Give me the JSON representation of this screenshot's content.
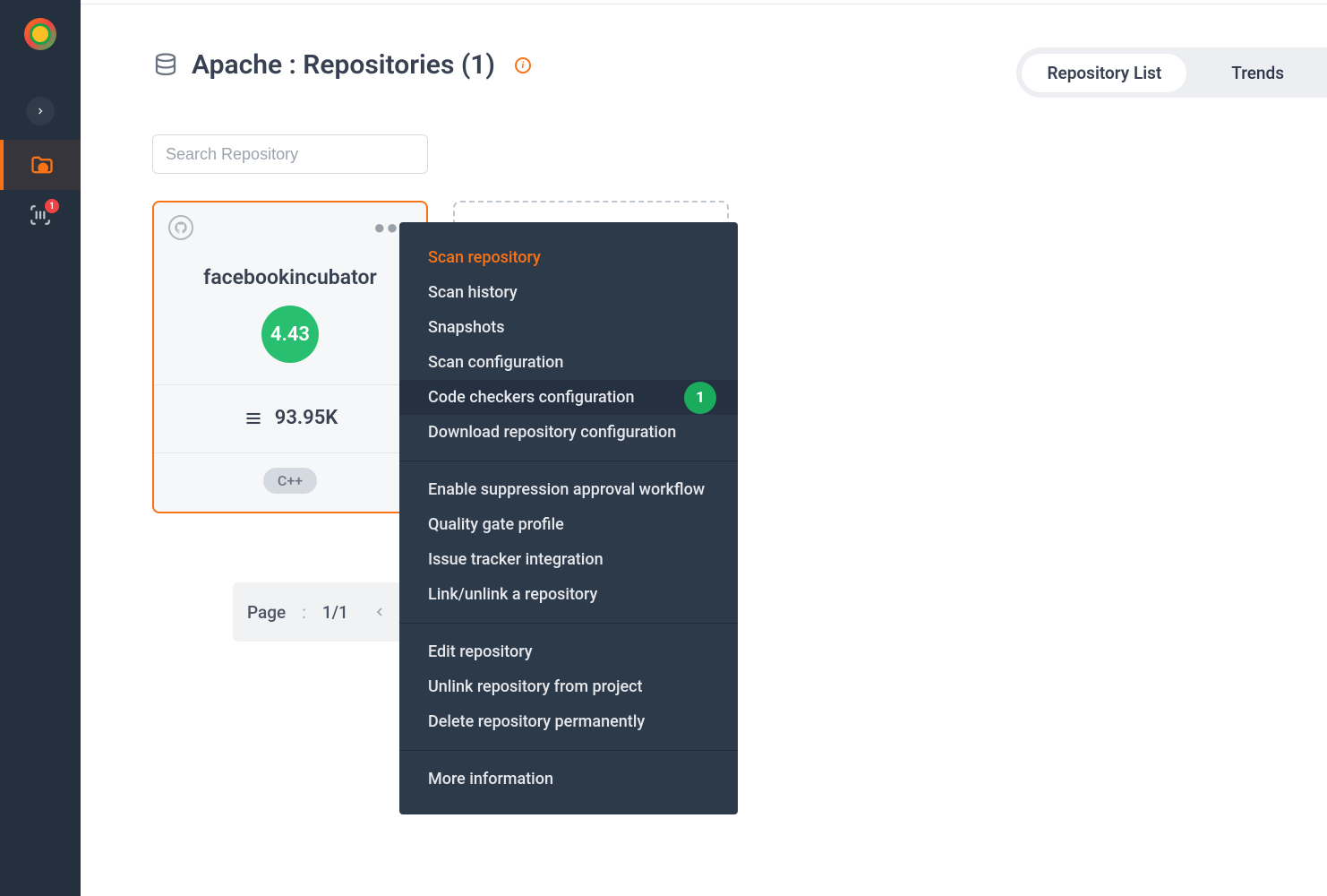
{
  "sidebar": {
    "scan_badge": "1"
  },
  "header": {
    "title": "Apache : Repositories (1)",
    "info_char": "i"
  },
  "tabs": {
    "list": "Repository List",
    "trends": "Trends"
  },
  "search": {
    "placeholder": "Search Repository"
  },
  "repo": {
    "name": "facebookincubator",
    "score": "4.43",
    "loc": "93.95K",
    "language": "C++"
  },
  "menu": {
    "g1": {
      "scan": "Scan repository",
      "history": "Scan history",
      "snapshots": "Snapshots",
      "config": "Scan configuration",
      "checkers": "Code checkers configuration",
      "checkers_badge": "1",
      "download": "Download repository configuration"
    },
    "g2": {
      "suppression": "Enable suppression approval workflow",
      "quality": "Quality gate profile",
      "tracker": "Issue tracker integration",
      "link": "Link/unlink a repository"
    },
    "g3": {
      "edit": "Edit repository",
      "unlink": "Unlink repository from project",
      "delete": "Delete repository permanently"
    },
    "g4": {
      "more": "More information"
    }
  },
  "pagination": {
    "label": "Page",
    "count": "1/1",
    "current": "1"
  }
}
